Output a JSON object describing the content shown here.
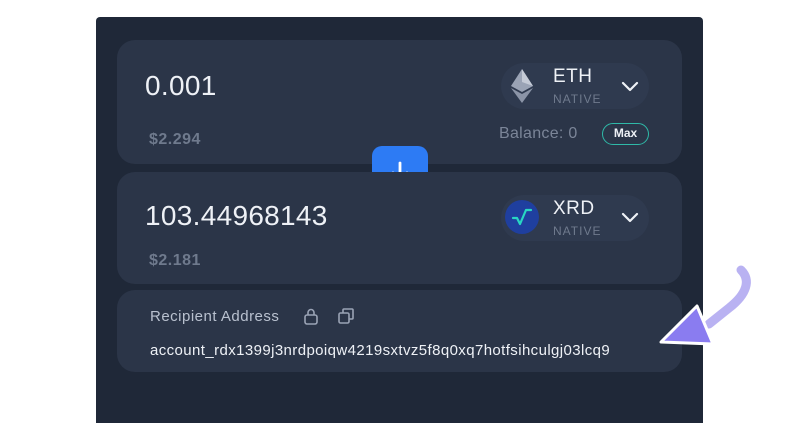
{
  "from": {
    "amount": "0.001",
    "fiat": "$2.294",
    "token": {
      "symbol": "ETH",
      "tag": "NATIVE",
      "icon": "ethereum-icon"
    },
    "balance_label": "Balance: 0",
    "max_label": "Max"
  },
  "swap": {
    "icon": "arrow-down-icon"
  },
  "to": {
    "amount": "103.44968143",
    "fiat": "$2.181",
    "token": {
      "symbol": "XRD",
      "tag": "NATIVE",
      "icon": "radix-icon"
    }
  },
  "recipient": {
    "label": "Recipient Address",
    "address": "account_rdx1399j3nrdpoiqw4219sxtvz5f8q0xq7hotfsihculgj03lcq9"
  },
  "colors": {
    "panel": "#1f2838",
    "card": "#2b3548",
    "accent_blue": "#2d7bf4",
    "max_border": "#2fb9a8",
    "cursor_purple": "#8a7cf0"
  }
}
